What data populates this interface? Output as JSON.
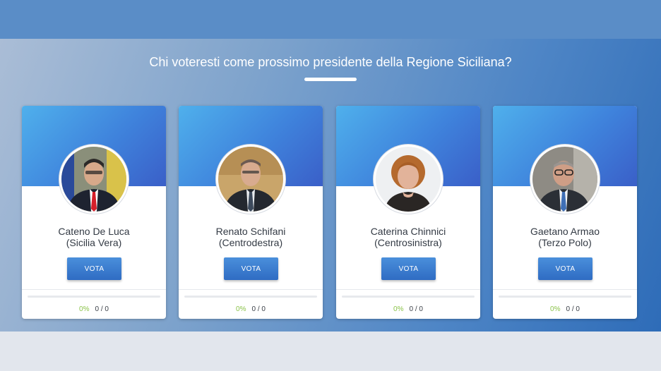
{
  "poll": {
    "question": "Chi voteresti come prossimo presidente della Regione Siciliana?"
  },
  "candidates": [
    {
      "name": "Cateno De Luca",
      "party": "(Sicilia Vera)",
      "vote_label": "VOTA",
      "percent": "0%",
      "percent_value": 0,
      "count": "0 / 0"
    },
    {
      "name": "Renato Schifani",
      "party": "(Centrodestra)",
      "vote_label": "VOTA",
      "percent": "0%",
      "percent_value": 0,
      "count": "0 / 0"
    },
    {
      "name": "Caterina Chinnici",
      "party": "(Centrosinistra)",
      "vote_label": "VOTA",
      "percent": "0%",
      "percent_value": 0,
      "count": "0 / 0"
    },
    {
      "name": "Gaetano Armao",
      "party": "(Terzo Polo)",
      "vote_label": "VOTA",
      "percent": "0%",
      "percent_value": 0,
      "count": "0 / 0"
    }
  ],
  "colors": {
    "accent": "#3f83dc",
    "button": "#2f6cc3",
    "percent": "#8bc34a"
  }
}
